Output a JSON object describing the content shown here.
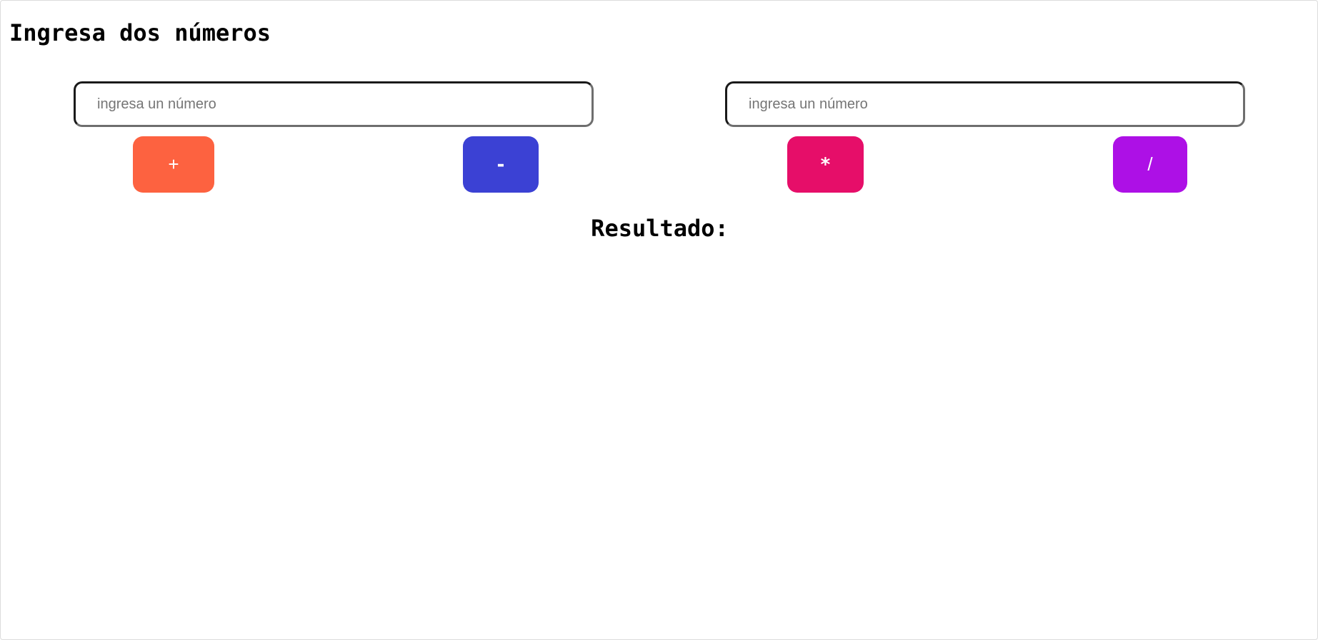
{
  "heading": "Ingresa dos números",
  "inputs": {
    "first": {
      "value": "",
      "placeholder": "ingresa un número"
    },
    "second": {
      "value": "",
      "placeholder": "ingresa un número"
    }
  },
  "buttons": {
    "add": {
      "label": "+",
      "color": "#fd6240"
    },
    "subtract": {
      "label": "-",
      "color": "#3b41d4"
    },
    "multiply": {
      "label": "*",
      "color": "#e60e69"
    },
    "divide": {
      "label": "/",
      "color": "#ad10e6"
    }
  },
  "result": {
    "label": "Resultado:"
  }
}
